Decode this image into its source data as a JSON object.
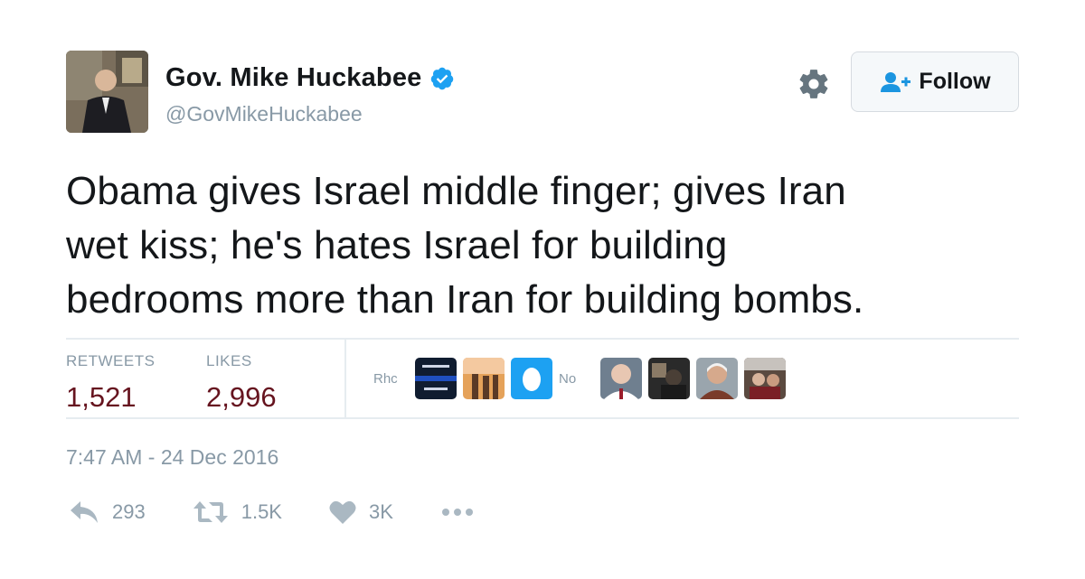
{
  "user": {
    "name": "Gov. Mike Huckabee",
    "handle": "@GovMikeHuckabee",
    "verified": true
  },
  "follow_button": {
    "label": "Follow"
  },
  "tweet": {
    "lines": [
      "Obama gives Israel middle finger; gives Iran",
      "wet kiss; he's hates Israel for building",
      "bedrooms more than Iran for building bombs."
    ]
  },
  "stats": {
    "retweets_label": "RETWEETS",
    "retweets_value": "1,521",
    "likes_label": "LIKES",
    "likes_value": "2,996"
  },
  "likers": {
    "truncated_name_1": "Rhc",
    "truncated_name_2": "No"
  },
  "timestamp": "7:47 AM - 24 Dec 2016",
  "actions": {
    "reply_count": "293",
    "retweet_count": "1.5K",
    "like_count": "3K"
  },
  "colors": {
    "verified_blue": "#1da1f2",
    "stat_value": "#66141f",
    "muted": "#8899a6",
    "follow_icon": "#1b95e0"
  }
}
